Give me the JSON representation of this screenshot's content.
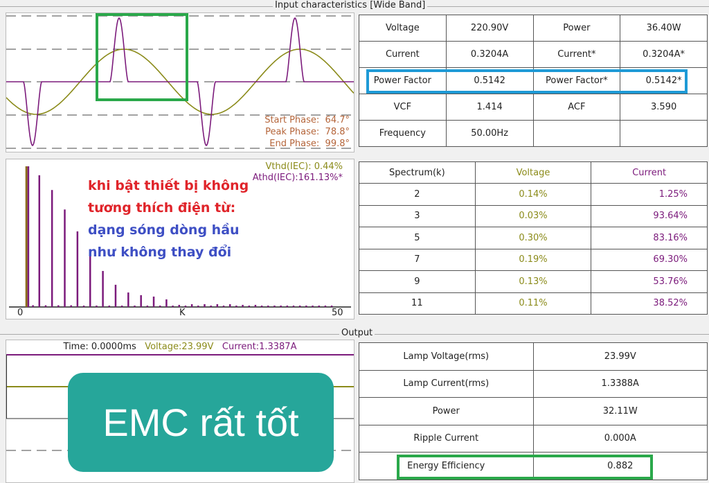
{
  "input": {
    "title": "Input characteristics [Wide Band]",
    "phase": {
      "start_label": "Start Phase:",
      "start": "64.7°",
      "peak_label": "Peak Phase:",
      "peak": "78.8°",
      "end_label": "End Phase:",
      "end": "99.8°"
    },
    "table": [
      [
        "Voltage",
        "220.90V",
        "Power",
        "36.40W"
      ],
      [
        "Current",
        "0.3204A",
        "Current*",
        "0.3204A*"
      ],
      [
        "Power Factor",
        "0.5142",
        "Power Factor*",
        "0.5142*"
      ],
      [
        "VCF",
        "1.414",
        "ACF",
        "3.590"
      ],
      [
        "Frequency",
        "50.00Hz",
        "",
        ""
      ]
    ]
  },
  "spectrum": {
    "vthd": "Vthd(IEC): 0.44%",
    "athd": "Athd(IEC):161.13%*",
    "annotation_red": [
      "khi bật thiết bị không",
      "tương thích điện từ:"
    ],
    "annotation_blue": [
      "dạng sóng dòng hầu",
      "như không thay đổi"
    ],
    "axis": {
      "min": "0",
      "mid": "K",
      "max": "50"
    },
    "table": {
      "headers": [
        "Spectrum(k)",
        "Voltage",
        "Current"
      ],
      "rows": [
        [
          "2",
          "0.14%",
          "1.25%"
        ],
        [
          "3",
          "0.03%",
          "93.64%"
        ],
        [
          "5",
          "0.30%",
          "83.16%"
        ],
        [
          "7",
          "0.19%",
          "69.30%"
        ],
        [
          "9",
          "0.13%",
          "53.76%"
        ],
        [
          "11",
          "0.11%",
          "38.52%"
        ]
      ]
    }
  },
  "output": {
    "title": "Output",
    "time": "Time: 0.0000ms",
    "voltage": "Voltage:23.99V",
    "current": "Current:1.3387A",
    "overlay": "EMC rất tốt",
    "table": [
      [
        "Lamp Voltage(rms)",
        "23.99V"
      ],
      [
        "Lamp Current(rms)",
        "1.3388A"
      ],
      [
        "Power",
        "32.11W"
      ],
      [
        "Ripple Current",
        "0.000A"
      ],
      [
        "Energy Efficiency",
        "0.882"
      ]
    ]
  },
  "colors": {
    "voltage": "#8b8b1a",
    "current": "#7b1a7b",
    "phase": "#b5653a",
    "highlight_blue": "#1e9ad6",
    "highlight_green": "#2aa84a",
    "overlay": "#26a69a",
    "red": "#e0242a",
    "blue": "#3e4fc4"
  },
  "chart_data": {
    "type": "bar",
    "title": "Harmonic spectrum",
    "xlabel": "K",
    "xlim": [
      0,
      50
    ],
    "current_percent": {
      "k": [
        1,
        2,
        3,
        4,
        5,
        6,
        7,
        8,
        9,
        10,
        11,
        12,
        13,
        14,
        15,
        16,
        17,
        18,
        19,
        20,
        21,
        22,
        23,
        24,
        25,
        26,
        27,
        28,
        29,
        30,
        31,
        32,
        33,
        34,
        35,
        36,
        37,
        38,
        39,
        40,
        41,
        42,
        43,
        44,
        45,
        46,
        47,
        48,
        49
      ],
      "values": [
        100,
        1.25,
        93.64,
        1.2,
        83.16,
        1.2,
        69.3,
        1.2,
        53.76,
        1,
        38.52,
        1,
        25.6,
        1,
        15.8,
        1,
        10.3,
        1,
        8.4,
        1,
        7.4,
        1,
        5.4,
        1,
        1.5,
        1,
        2,
        1,
        2,
        1,
        2,
        1,
        2,
        1,
        1.5,
        1,
        1.5,
        1,
        1,
        1,
        1,
        1,
        1,
        1,
        1,
        1,
        1,
        1,
        1
      ]
    },
    "voltage_percent": {
      "k": [
        1
      ],
      "values": [
        100
      ]
    }
  }
}
